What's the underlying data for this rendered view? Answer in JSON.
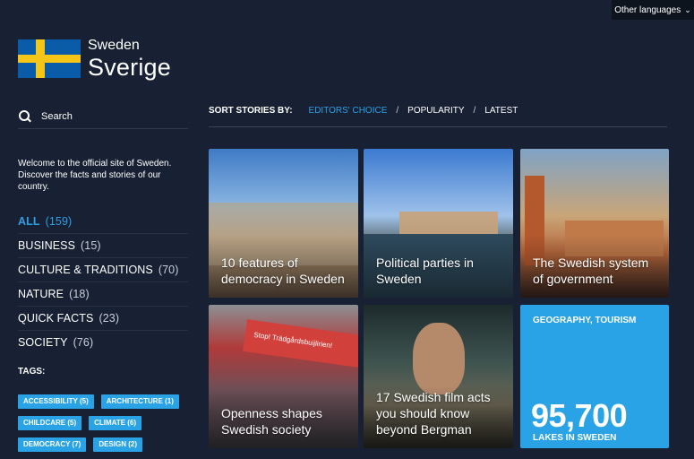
{
  "topbar": {
    "languages_label": "Other languages"
  },
  "brand": {
    "name_en": "Sweden",
    "name_sv": "Sverige"
  },
  "search": {
    "label": "Search"
  },
  "welcome": "Welcome to the official site of Sweden. Discover the facts and stories of our country.",
  "categories": [
    {
      "name": "ALL",
      "count": "(159)"
    },
    {
      "name": "BUSINESS",
      "count": "(15)"
    },
    {
      "name": "CULTURE & TRADITIONS",
      "count": "(70)"
    },
    {
      "name": "NATURE",
      "count": "(18)"
    },
    {
      "name": "QUICK FACTS",
      "count": "(23)"
    },
    {
      "name": "SOCIETY",
      "count": "(76)"
    }
  ],
  "tags_label": "TAGS:",
  "tags": [
    "ACCESSIBILITY (5)",
    "ARCHITECTURE (1)",
    "CHILDCARE (5)",
    "CLIMATE (6)",
    "DEMOCRACY (7)",
    "DESIGN (2)"
  ],
  "sort": {
    "label": "SORT STORIES BY:",
    "options": [
      "EDITORS' CHOICE",
      "POPULARITY",
      "LATEST"
    ],
    "active": "EDITORS' CHOICE"
  },
  "stories": [
    {
      "title": "10 features of democracy in Sweden"
    },
    {
      "title": "Political parties in Sweden"
    },
    {
      "title": "The Swedish system of government"
    },
    {
      "title": "Openness shapes Swedish society",
      "banner": "Stop! Trädgårdsbuijlirien!"
    },
    {
      "title": "17 Swedish film acts you should know beyond Bergman"
    }
  ],
  "fact_card": {
    "category": "GEOGRAPHY, TOURISM",
    "number": "95,700",
    "caption": "LAKES IN SWEDEN"
  },
  "colors": {
    "accent": "#2f9fe3",
    "background": "#172133",
    "tag": "#29a3e5",
    "flag_blue": "#0a5ca8",
    "flag_yellow": "#f5c518"
  }
}
